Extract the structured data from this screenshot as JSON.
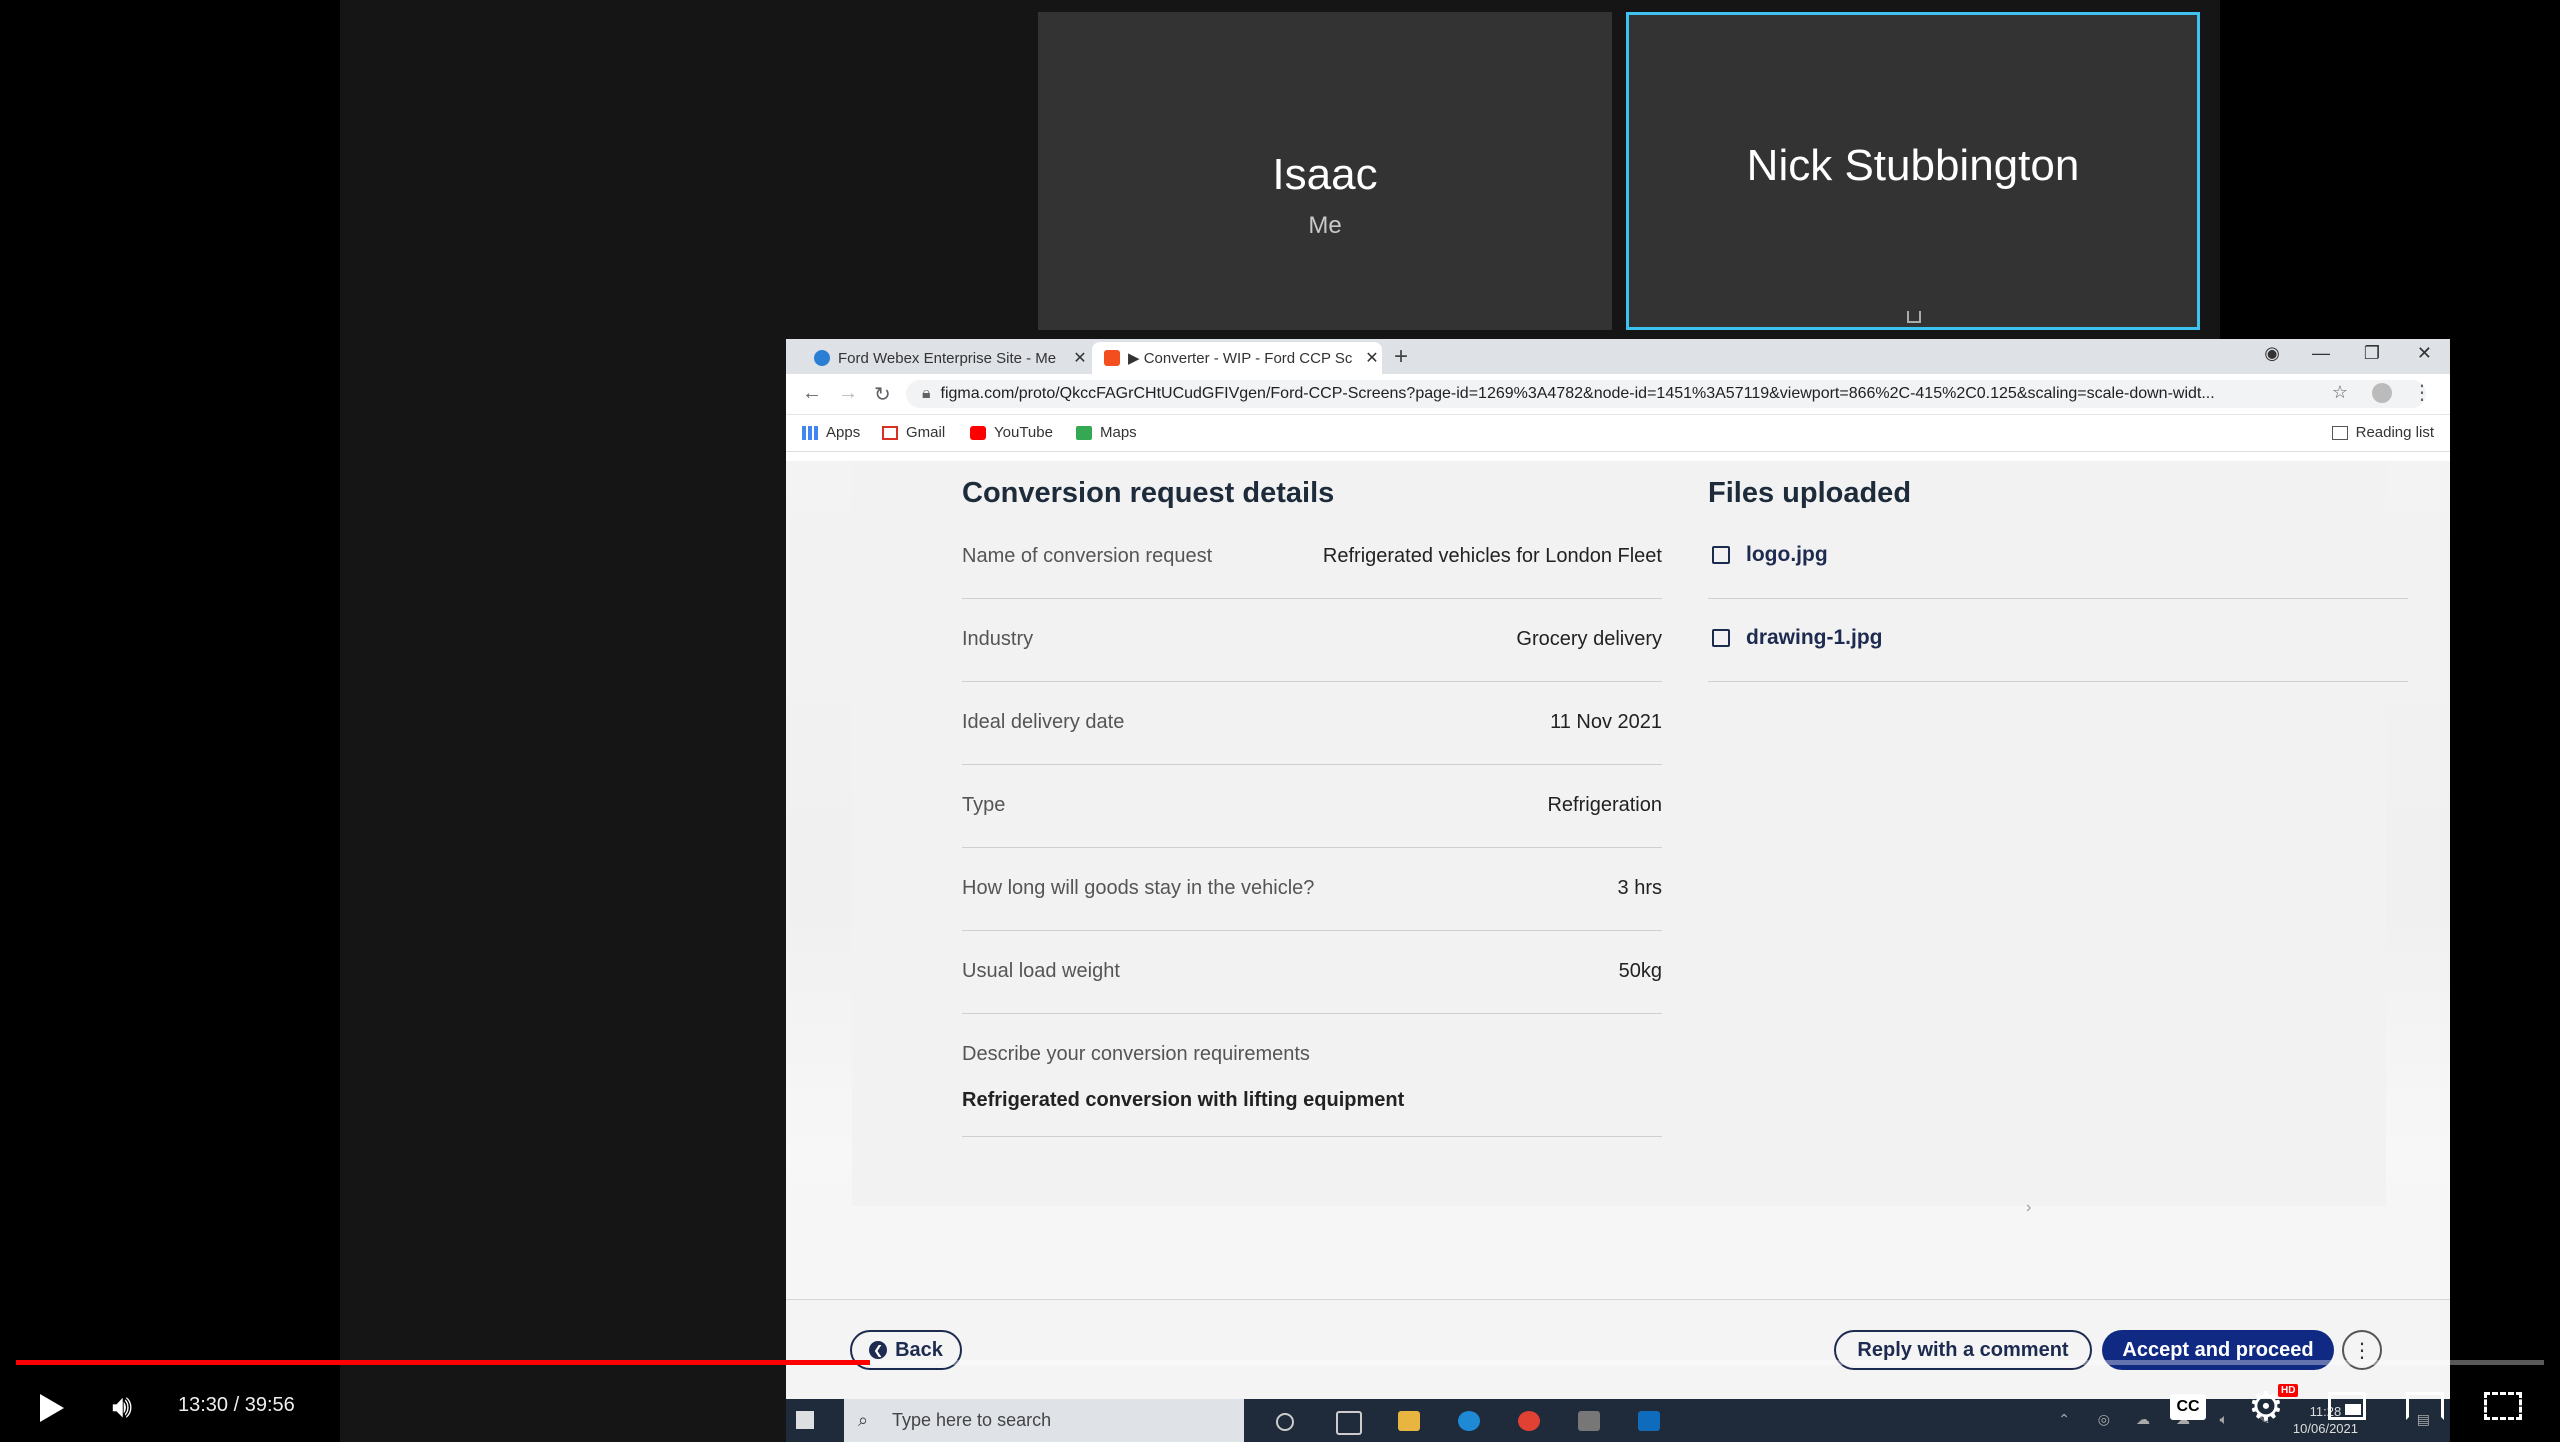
{
  "meeting": {
    "participants": [
      {
        "name": "Isaac",
        "subtitle": "Me"
      },
      {
        "name": "Nick Stubbington"
      }
    ]
  },
  "browser": {
    "tabs": [
      {
        "title": "Ford Webex Enterprise Site - Me",
        "close": "✕"
      },
      {
        "title": "▶ Converter - WIP - Ford CCP Sc",
        "close": "✕"
      }
    ],
    "new_tab": "+",
    "url": "figma.com/proto/QkccFAGrCHtUCudGFIVgen/Ford-CCP-Screens?page-id=1269%3A4782&node-id=1451%3A57119&viewport=866%2C-415%2C0.125&scaling=scale-down-widt...",
    "bookmarks": [
      "Apps",
      "Gmail",
      "YouTube",
      "Maps"
    ],
    "reading_list": "Reading list"
  },
  "details": {
    "title": "Conversion request details",
    "rows": [
      {
        "label": "Name of conversion request",
        "value": "Refrigerated vehicles for London Fleet"
      },
      {
        "label": "Industry",
        "value": "Grocery delivery"
      },
      {
        "label": "Ideal delivery date",
        "value": "11 Nov 2021"
      },
      {
        "label": "Type",
        "value": "Refrigeration"
      },
      {
        "label": "How long will goods stay in the vehicle?",
        "value": "3 hrs"
      },
      {
        "label": "Usual load weight",
        "value": "50kg"
      }
    ],
    "description": {
      "label": "Describe your conversion requirements",
      "value": "Refrigerated conversion with lifting equipment"
    }
  },
  "files": {
    "title": "Files uploaded",
    "items": [
      "logo.jpg",
      "drawing-1.jpg"
    ]
  },
  "actions": {
    "back": "Back",
    "reply": "Reply with a comment",
    "accept": "Accept and proceed",
    "more": "⋮"
  },
  "taskbar": {
    "search_placeholder": "Type here to search",
    "time": "11:28",
    "date": "10/06/2021"
  },
  "player": {
    "time_display": "13:30 / 39:56",
    "progress_fraction": 0.338,
    "cc_label": "CC",
    "hd_badge": "HD",
    "colors": {
      "progress": "#ff0000",
      "active_speaker": "#3ec2f2",
      "accept_button": "#102a83"
    }
  }
}
